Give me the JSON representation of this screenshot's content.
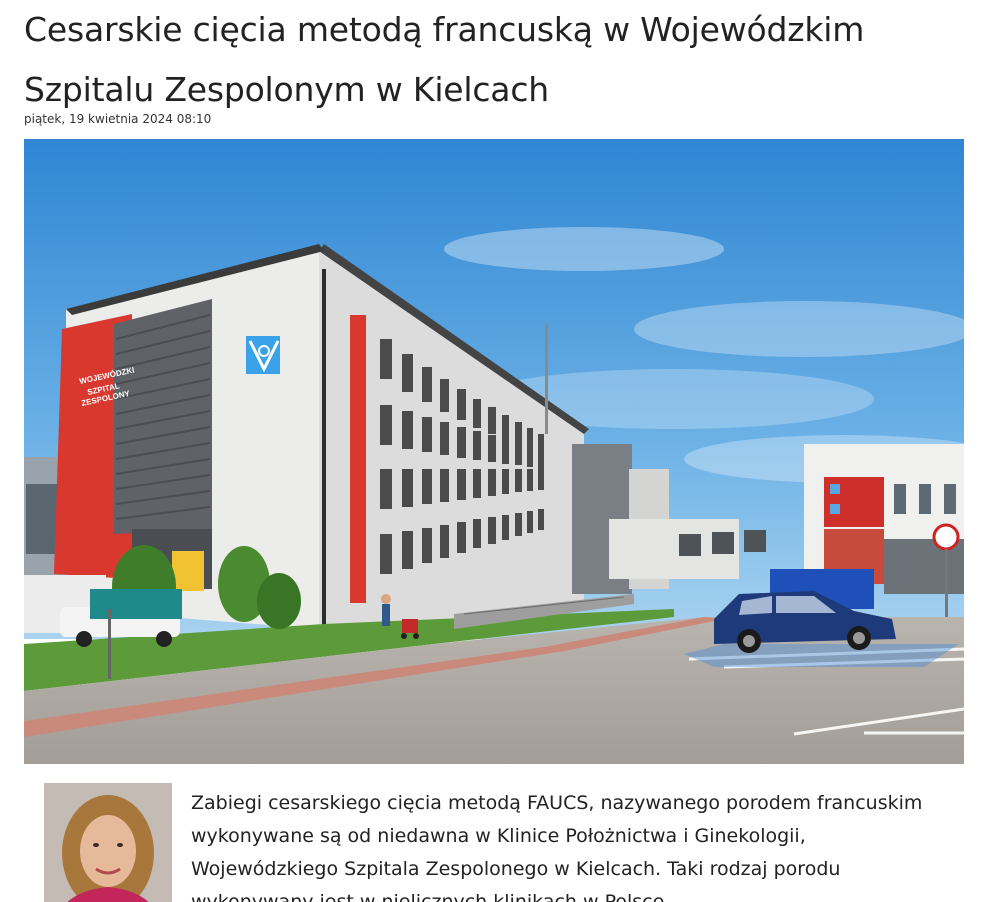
{
  "article": {
    "title": "Cesarskie cięcia metodą francuską w Wojewódzkim Szpitalu Zespolonym w Kielcach",
    "date": "piątek, 19 kwietnia 2024 08:10",
    "lead": "Zabiegi cesarskiego cięcia metodą FAUCS, nazywanego porodem francuskim wykonywane są od niedawna w Klinice Położnictwa i Ginekologii, Wojewódzkiego Szpitala Zespolonego w Kielcach. Taki rodzaj porodu wykonywany jest w nielicznych klinikach w Polsce."
  },
  "hero_image": {
    "sign_lines": [
      "WOJEWÓDZKI",
      "SZPITAL",
      "ZESPOLONY"
    ],
    "colors": {
      "sky": "#3b8fd6",
      "facade": "#e9e9e7",
      "red_accent": "#d9382f",
      "grass": "#5c9a3a",
      "car": "#1f3a7a"
    }
  },
  "portrait": {
    "alt_subject": "author-portrait"
  }
}
